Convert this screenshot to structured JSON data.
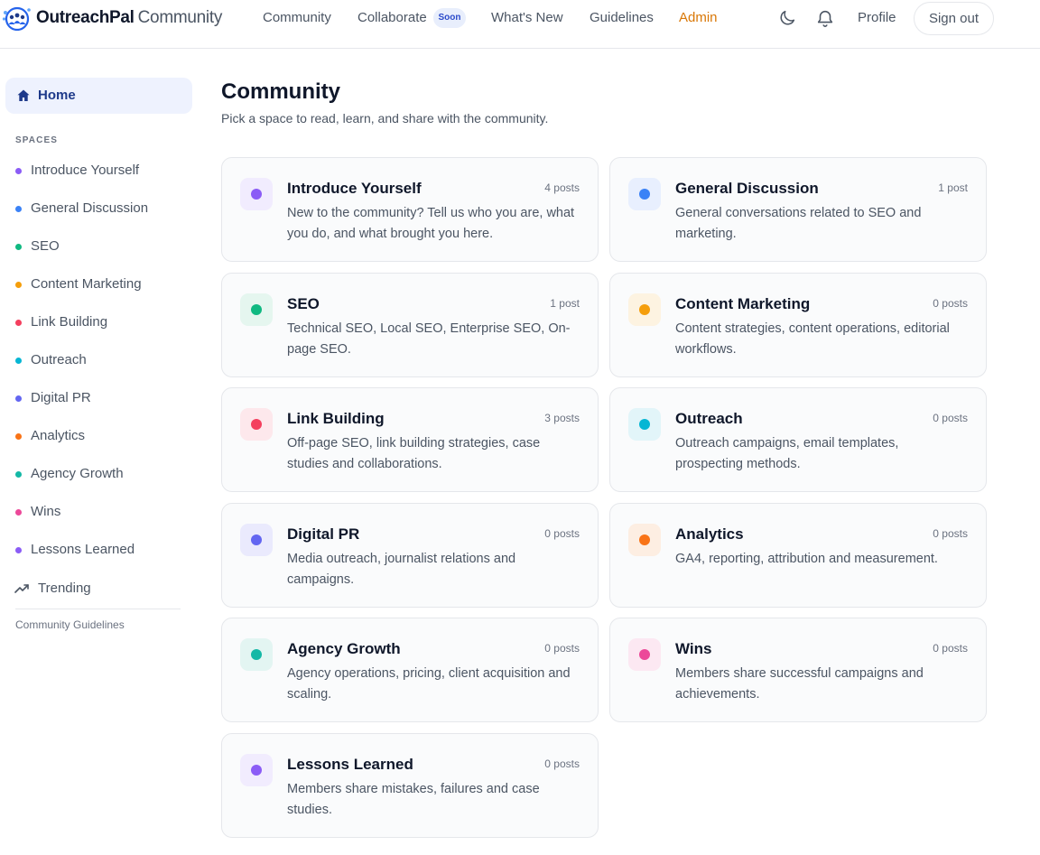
{
  "app": {
    "brand": "OutreachPal",
    "brand_suffix": "Community"
  },
  "nav": {
    "community": "Community",
    "collaborate": "Collaborate",
    "soon_badge": "Soon",
    "whats_new": "What's New",
    "guidelines": "Guidelines",
    "admin": "Admin",
    "profile": "Profile",
    "sign_out": "Sign out"
  },
  "icons": {
    "theme": "moon-icon",
    "notifications": "bell-icon",
    "home": "home-icon",
    "trending": "trending-up-icon"
  },
  "sidebar": {
    "home": "Home",
    "spaces_heading": "SPACES",
    "items": [
      {
        "label": "Introduce Yourself",
        "color": "#8b5cf6"
      },
      {
        "label": "General Discussion",
        "color": "#3b82f6"
      },
      {
        "label": "SEO",
        "color": "#10b981"
      },
      {
        "label": "Content Marketing",
        "color": "#f59e0b"
      },
      {
        "label": "Link Building",
        "color": "#f43f5e"
      },
      {
        "label": "Outreach",
        "color": "#06b6d4"
      },
      {
        "label": "Digital PR",
        "color": "#6366f1"
      },
      {
        "label": "Analytics",
        "color": "#f97316"
      },
      {
        "label": "Agency Growth",
        "color": "#14b8a6"
      },
      {
        "label": "Wins",
        "color": "#ec4899"
      },
      {
        "label": "Lessons Learned",
        "color": "#8b5cf6"
      }
    ],
    "trending": "Trending",
    "guidelines": "Community Guidelines"
  },
  "main": {
    "title": "Community",
    "subtitle": "Pick a space to read, learn, and share with the community.",
    "spaces": [
      {
        "title": "Introduce Yourself",
        "count": "4 posts",
        "description": "New to the community? Tell us who you are, what you do, and what brought you here.",
        "color": "#8b5cf6",
        "tint": "#f1ecfe"
      },
      {
        "title": "General Discussion",
        "count": "1 post",
        "description": "General conversations related to SEO and marketing.",
        "color": "#3b82f6",
        "tint": "#e8effe"
      },
      {
        "title": "SEO",
        "count": "1 post",
        "description": "Technical SEO, Local SEO, Enterprise SEO, On-page SEO.",
        "color": "#10b981",
        "tint": "#e5f6ef"
      },
      {
        "title": "Content Marketing",
        "count": "0 posts",
        "description": "Content strategies, content operations, editorial workflows.",
        "color": "#f59e0b",
        "tint": "#fdf3e1"
      },
      {
        "title": "Link Building",
        "count": "3 posts",
        "description": "Off-page SEO, link building strategies, case studies and collaborations.",
        "color": "#f43f5e",
        "tint": "#fde8ec"
      },
      {
        "title": "Outreach",
        "count": "0 posts",
        "description": "Outreach campaigns, email templates, prospecting methods.",
        "color": "#06b6d4",
        "tint": "#e2f5f9"
      },
      {
        "title": "Digital PR",
        "count": "0 posts",
        "description": "Media outreach, journalist relations and campaigns.",
        "color": "#6366f1",
        "tint": "#eaeafd"
      },
      {
        "title": "Analytics",
        "count": "0 posts",
        "description": "GA4, reporting, attribution and measurement.",
        "color": "#f97316",
        "tint": "#fdeee2"
      },
      {
        "title": "Agency Growth",
        "count": "0 posts",
        "description": "Agency operations, pricing, client acquisition and scaling.",
        "color": "#14b8a6",
        "tint": "#e3f5f2"
      },
      {
        "title": "Wins",
        "count": "0 posts",
        "description": "Members share successful campaigns and achievements.",
        "color": "#ec4899",
        "tint": "#fce8f2"
      },
      {
        "title": "Lessons Learned",
        "count": "0 posts",
        "description": "Members share mistakes, failures and case studies.",
        "color": "#8b5cf6",
        "tint": "#f1ecfe"
      }
    ]
  }
}
